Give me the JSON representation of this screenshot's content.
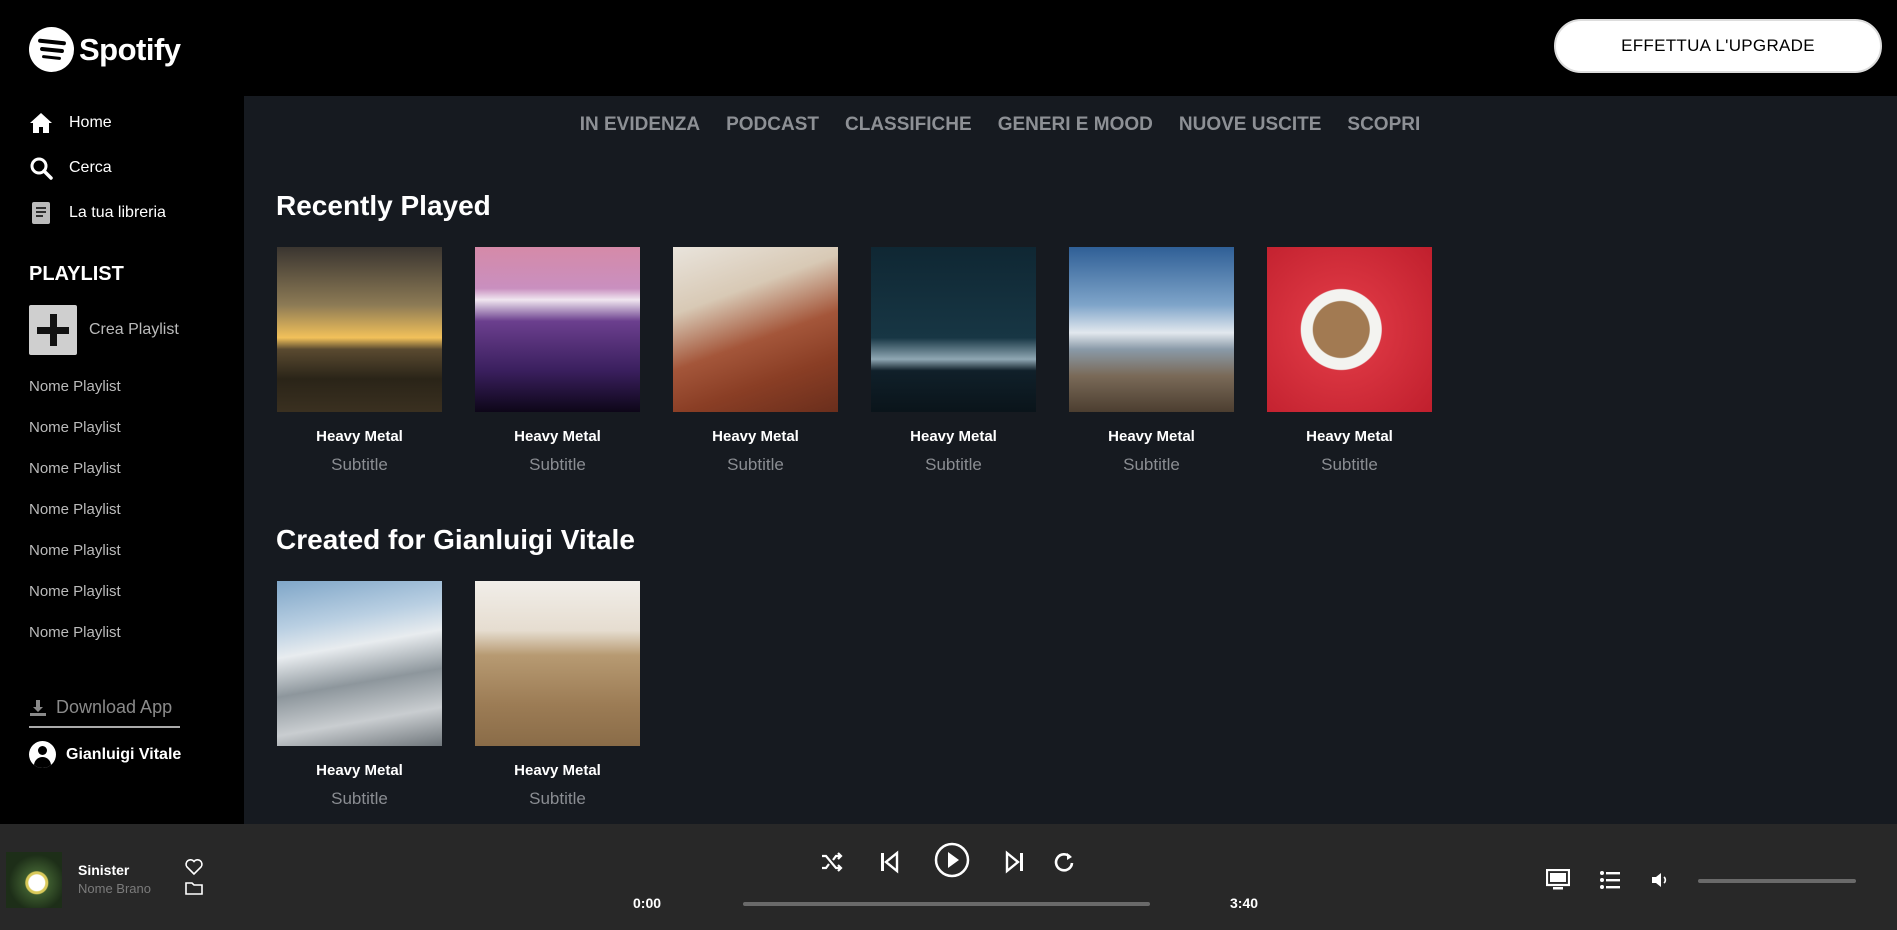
{
  "app": {
    "brand": "Spotify",
    "upgrade_label": "EFFETTUA L'UPGRADE"
  },
  "sidebar": {
    "nav": [
      {
        "label": "Home",
        "icon": "home-icon"
      },
      {
        "label": "Cerca",
        "icon": "search-icon"
      },
      {
        "label": "La tua libreria",
        "icon": "library-icon"
      }
    ],
    "playlist_heading": "PLAYLIST",
    "create_playlist": "Crea Playlist",
    "playlists": [
      "Nome Playlist",
      "Nome Playlist",
      "Nome Playlist",
      "Nome Playlist",
      "Nome Playlist",
      "Nome Playlist",
      "Nome Playlist"
    ],
    "download_label": "Download App",
    "user_name": "Gianluigi Vitale"
  },
  "tabs": [
    "IN EVIDENZA",
    "PODCAST",
    "CLASSIFICHE",
    "GENERI E MOOD",
    "NUOVE USCITE",
    "SCOPRI"
  ],
  "sections": [
    {
      "title": "Recently Played",
      "cards": [
        {
          "title": "Heavy Metal",
          "subtitle": "Subtitle"
        },
        {
          "title": "Heavy Metal",
          "subtitle": "Subtitle"
        },
        {
          "title": "Heavy Metal",
          "subtitle": "Subtitle"
        },
        {
          "title": "Heavy Metal",
          "subtitle": "Subtitle"
        },
        {
          "title": "Heavy Metal",
          "subtitle": "Subtitle"
        },
        {
          "title": "Heavy Metal",
          "subtitle": "Subtitle"
        }
      ]
    },
    {
      "title": "Created for Gianluigi Vitale",
      "cards": [
        {
          "title": "Heavy Metal",
          "subtitle": "Subtitle"
        },
        {
          "title": "Heavy Metal",
          "subtitle": "Subtitle"
        }
      ]
    }
  ],
  "player": {
    "track_title": "Sinister",
    "track_subtitle": "Nome Brano",
    "current_time": "0:00",
    "total_time": "3:40",
    "progress": 0,
    "volume": 0
  },
  "colors": {
    "main_bg": "#161a20",
    "sidebar_bg": "#000000",
    "player_bg": "#282828",
    "muted_text": "#8d9095"
  }
}
